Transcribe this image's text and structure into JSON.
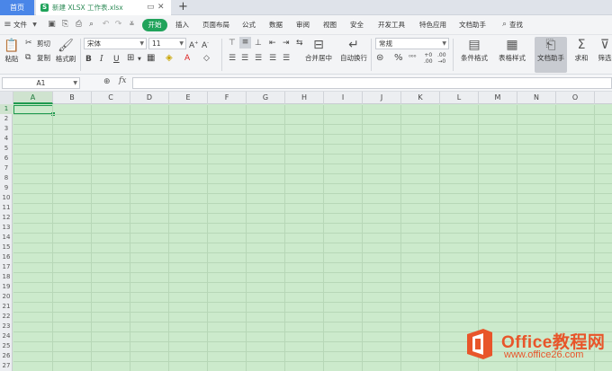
{
  "tabs": {
    "home_label": "首页",
    "doc_label": "新建 XLSX 工作表.xlsx",
    "doc_icon": "S"
  },
  "menu": {
    "file_label": "文件",
    "items": [
      "开始",
      "插入",
      "页面布局",
      "公式",
      "数据",
      "审阅",
      "视图",
      "安全",
      "开发工具",
      "特色应用",
      "文档助手"
    ],
    "search_label": "查找",
    "accent": "#21a35b"
  },
  "ribbon": {
    "paste_label": "粘贴",
    "cut_label": "剪切",
    "copy_label": "复制",
    "format_painter_label": "格式刷",
    "font_name": "宋体",
    "font_size": "11",
    "merge_center_label": "合并居中",
    "wrap_text_label": "自动换行",
    "number_format": "常规",
    "conditional_format_label": "条件格式",
    "table_style_label": "表格样式",
    "doc_assistant_label": "文档助手",
    "sum_label": "求和",
    "filter_label": "筛选"
  },
  "formula_bar": {
    "cell_ref": "A1",
    "fx_label": "fx",
    "formula": ""
  },
  "grid": {
    "columns": [
      "A",
      "B",
      "C",
      "D",
      "E",
      "F",
      "G",
      "H",
      "I",
      "J",
      "K",
      "L",
      "M",
      "N",
      "O"
    ],
    "rows": [
      "1",
      "2",
      "3",
      "4",
      "5",
      "6",
      "7",
      "8",
      "9",
      "10",
      "11",
      "12",
      "13",
      "14",
      "15",
      "16",
      "17",
      "18",
      "19",
      "20",
      "21",
      "22",
      "23",
      "24",
      "25",
      "26",
      "27"
    ],
    "selected_cell": "A1",
    "cell_background": "#cceacc"
  },
  "watermark": {
    "title": "Office教程网",
    "url": "www.office26.com"
  }
}
